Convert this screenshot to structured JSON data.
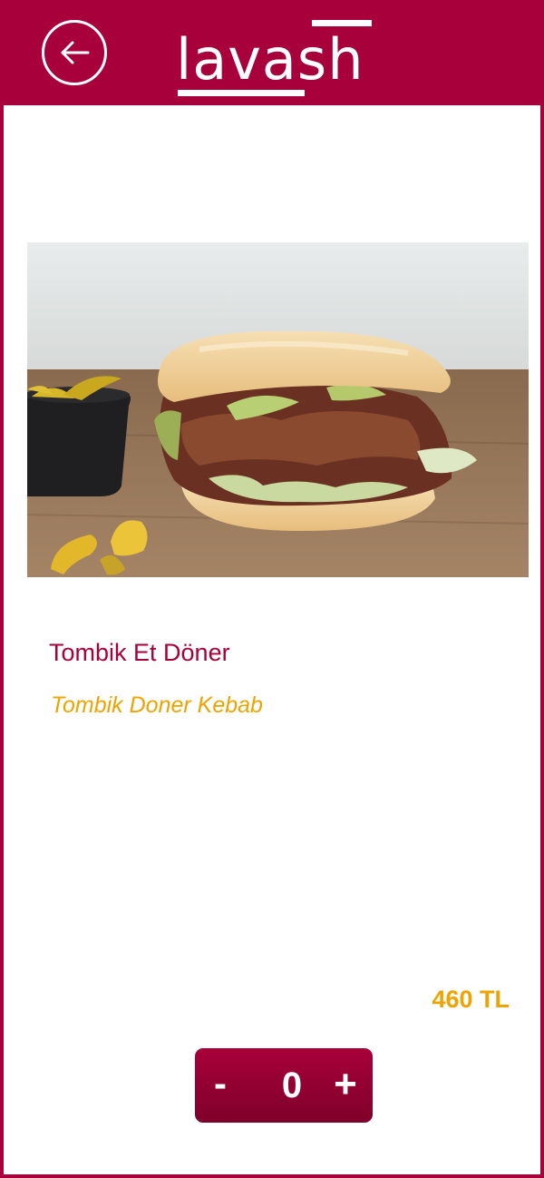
{
  "header": {
    "logo_text": "lavash",
    "back_icon": "arrow-left-icon"
  },
  "colors": {
    "brand": "#a8003a",
    "accent": "#efa300",
    "background": "#ffffff"
  },
  "product": {
    "image": "doner-sandwich-photo",
    "name": "Tombik Et Döner",
    "subtitle": "Tombik Doner Kebab",
    "price": "460 TL"
  },
  "stepper": {
    "minus_label": "-",
    "quantity": "0",
    "plus_label": "+"
  }
}
